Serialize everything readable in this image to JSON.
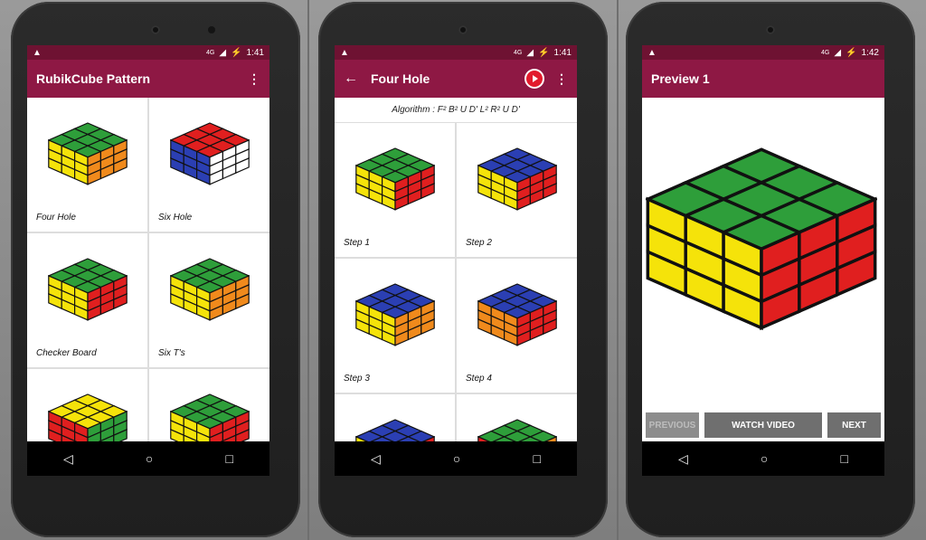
{
  "status": {
    "signal": "4G",
    "battery": "⚡",
    "time_1": "1:41",
    "time_2": "1:41",
    "time_3": "1:42"
  },
  "screen1": {
    "title": "RubikCube Pattern",
    "items": [
      {
        "label": "Four Hole"
      },
      {
        "label": "Six Hole"
      },
      {
        "label": "Checker Board"
      },
      {
        "label": "Six T's"
      },
      {
        "label": ""
      },
      {
        "label": ""
      }
    ]
  },
  "screen2": {
    "title": "Four Hole",
    "algorithm": "Algorithm : F² B² U D' L² R² U D'",
    "steps": [
      {
        "label": "Step 1"
      },
      {
        "label": "Step 2"
      },
      {
        "label": "Step 3"
      },
      {
        "label": "Step 4"
      },
      {
        "label": ""
      },
      {
        "label": ""
      }
    ]
  },
  "screen3": {
    "title": "Preview 1",
    "buttons": {
      "previous": "PREVIOUS",
      "watch": "WATCH VIDEO",
      "next": "NEXT"
    }
  },
  "colors": {
    "statusbar": "#6e1232",
    "appbar": "#8e1844"
  }
}
